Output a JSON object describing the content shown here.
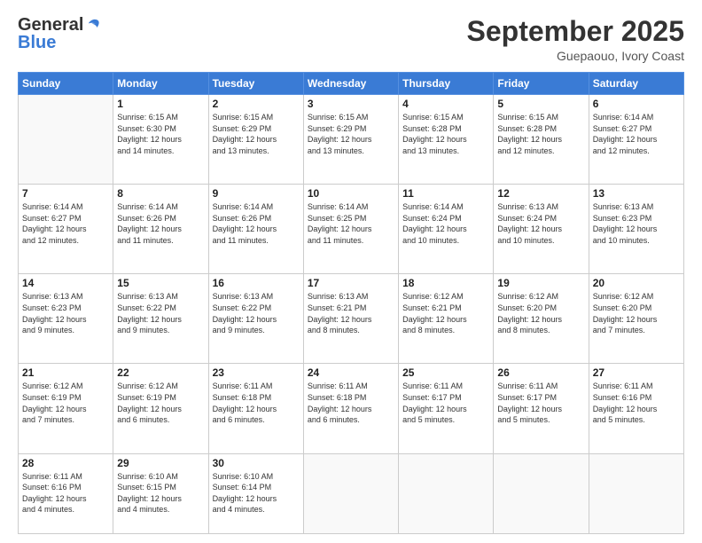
{
  "header": {
    "logo_general": "General",
    "logo_blue": "Blue",
    "month_title": "September 2025",
    "subtitle": "Guepaouo, Ivory Coast"
  },
  "weekdays": [
    "Sunday",
    "Monday",
    "Tuesday",
    "Wednesday",
    "Thursday",
    "Friday",
    "Saturday"
  ],
  "weeks": [
    [
      {
        "day": "",
        "info": ""
      },
      {
        "day": "1",
        "info": "Sunrise: 6:15 AM\nSunset: 6:30 PM\nDaylight: 12 hours\nand 14 minutes."
      },
      {
        "day": "2",
        "info": "Sunrise: 6:15 AM\nSunset: 6:29 PM\nDaylight: 12 hours\nand 13 minutes."
      },
      {
        "day": "3",
        "info": "Sunrise: 6:15 AM\nSunset: 6:29 PM\nDaylight: 12 hours\nand 13 minutes."
      },
      {
        "day": "4",
        "info": "Sunrise: 6:15 AM\nSunset: 6:28 PM\nDaylight: 12 hours\nand 13 minutes."
      },
      {
        "day": "5",
        "info": "Sunrise: 6:15 AM\nSunset: 6:28 PM\nDaylight: 12 hours\nand 12 minutes."
      },
      {
        "day": "6",
        "info": "Sunrise: 6:14 AM\nSunset: 6:27 PM\nDaylight: 12 hours\nand 12 minutes."
      }
    ],
    [
      {
        "day": "7",
        "info": "Sunrise: 6:14 AM\nSunset: 6:27 PM\nDaylight: 12 hours\nand 12 minutes."
      },
      {
        "day": "8",
        "info": "Sunrise: 6:14 AM\nSunset: 6:26 PM\nDaylight: 12 hours\nand 11 minutes."
      },
      {
        "day": "9",
        "info": "Sunrise: 6:14 AM\nSunset: 6:26 PM\nDaylight: 12 hours\nand 11 minutes."
      },
      {
        "day": "10",
        "info": "Sunrise: 6:14 AM\nSunset: 6:25 PM\nDaylight: 12 hours\nand 11 minutes."
      },
      {
        "day": "11",
        "info": "Sunrise: 6:14 AM\nSunset: 6:24 PM\nDaylight: 12 hours\nand 10 minutes."
      },
      {
        "day": "12",
        "info": "Sunrise: 6:13 AM\nSunset: 6:24 PM\nDaylight: 12 hours\nand 10 minutes."
      },
      {
        "day": "13",
        "info": "Sunrise: 6:13 AM\nSunset: 6:23 PM\nDaylight: 12 hours\nand 10 minutes."
      }
    ],
    [
      {
        "day": "14",
        "info": "Sunrise: 6:13 AM\nSunset: 6:23 PM\nDaylight: 12 hours\nand 9 minutes."
      },
      {
        "day": "15",
        "info": "Sunrise: 6:13 AM\nSunset: 6:22 PM\nDaylight: 12 hours\nand 9 minutes."
      },
      {
        "day": "16",
        "info": "Sunrise: 6:13 AM\nSunset: 6:22 PM\nDaylight: 12 hours\nand 9 minutes."
      },
      {
        "day": "17",
        "info": "Sunrise: 6:13 AM\nSunset: 6:21 PM\nDaylight: 12 hours\nand 8 minutes."
      },
      {
        "day": "18",
        "info": "Sunrise: 6:12 AM\nSunset: 6:21 PM\nDaylight: 12 hours\nand 8 minutes."
      },
      {
        "day": "19",
        "info": "Sunrise: 6:12 AM\nSunset: 6:20 PM\nDaylight: 12 hours\nand 8 minutes."
      },
      {
        "day": "20",
        "info": "Sunrise: 6:12 AM\nSunset: 6:20 PM\nDaylight: 12 hours\nand 7 minutes."
      }
    ],
    [
      {
        "day": "21",
        "info": "Sunrise: 6:12 AM\nSunset: 6:19 PM\nDaylight: 12 hours\nand 7 minutes."
      },
      {
        "day": "22",
        "info": "Sunrise: 6:12 AM\nSunset: 6:19 PM\nDaylight: 12 hours\nand 6 minutes."
      },
      {
        "day": "23",
        "info": "Sunrise: 6:11 AM\nSunset: 6:18 PM\nDaylight: 12 hours\nand 6 minutes."
      },
      {
        "day": "24",
        "info": "Sunrise: 6:11 AM\nSunset: 6:18 PM\nDaylight: 12 hours\nand 6 minutes."
      },
      {
        "day": "25",
        "info": "Sunrise: 6:11 AM\nSunset: 6:17 PM\nDaylight: 12 hours\nand 5 minutes."
      },
      {
        "day": "26",
        "info": "Sunrise: 6:11 AM\nSunset: 6:17 PM\nDaylight: 12 hours\nand 5 minutes."
      },
      {
        "day": "27",
        "info": "Sunrise: 6:11 AM\nSunset: 6:16 PM\nDaylight: 12 hours\nand 5 minutes."
      }
    ],
    [
      {
        "day": "28",
        "info": "Sunrise: 6:11 AM\nSunset: 6:16 PM\nDaylight: 12 hours\nand 4 minutes."
      },
      {
        "day": "29",
        "info": "Sunrise: 6:10 AM\nSunset: 6:15 PM\nDaylight: 12 hours\nand 4 minutes."
      },
      {
        "day": "30",
        "info": "Sunrise: 6:10 AM\nSunset: 6:14 PM\nDaylight: 12 hours\nand 4 minutes."
      },
      {
        "day": "",
        "info": ""
      },
      {
        "day": "",
        "info": ""
      },
      {
        "day": "",
        "info": ""
      },
      {
        "day": "",
        "info": ""
      }
    ]
  ]
}
